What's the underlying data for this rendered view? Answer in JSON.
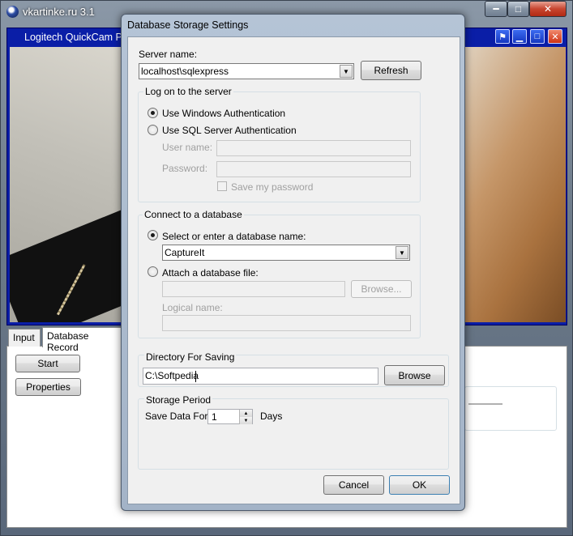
{
  "main_window": {
    "title": "vkartinke.ru 3.1",
    "minimize": "━",
    "maximize": "□",
    "close": "✕"
  },
  "video_window": {
    "title": "Logitech QuickCam Pro",
    "pin": "⚑",
    "minimize": "▁",
    "maximize": "□",
    "close": "✕"
  },
  "tabs": [
    {
      "label": "Input"
    },
    {
      "label": "Database Record"
    }
  ],
  "lower_panel": {
    "start_label": "Start",
    "properties_label": "Properties"
  },
  "dialog": {
    "title": "Database Storage Settings",
    "server_name_label": "Server name:",
    "server_name_value": "localhost\\sqlexpress",
    "refresh_label": "Refresh",
    "logon_group": "Log on to the server",
    "windows_auth": "Use Windows Authentication",
    "sql_auth": "Use SQL Server Authentication",
    "user_name_label": "User name:",
    "password_label": "Password:",
    "save_password": "Save my password",
    "connect_group": "Connect to a database",
    "select_db": "Select or enter a database name:",
    "db_value": "CaptureIt",
    "attach_db": "Attach a database file:",
    "browse_disabled": "Browse...",
    "logical_name": "Logical name:",
    "directory_group": "Directory For Saving",
    "directory_value": "C:\\Softpedia",
    "browse_label": "Browse",
    "storage_group": "Storage Period",
    "save_data_for": "Save Data For",
    "days_value": "1",
    "days_label": "Days",
    "cancel_label": "Cancel",
    "ok_label": "OK"
  }
}
